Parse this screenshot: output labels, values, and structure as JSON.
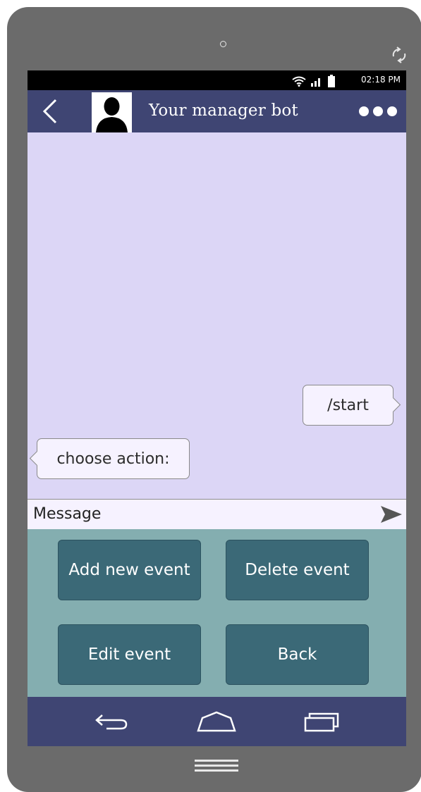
{
  "status_bar": {
    "time": "02:18 PM",
    "icons": [
      "wifi-icon",
      "signal-icon",
      "battery-icon"
    ]
  },
  "app_bar": {
    "title": "Your manager bot",
    "back_icon": "chevron-left-icon",
    "avatar_icon": "person-icon",
    "menu_icon": "more-dots-icon"
  },
  "chat": {
    "messages": [
      {
        "direction": "out",
        "text": "/start"
      },
      {
        "direction": "in",
        "text": "choose action:"
      }
    ]
  },
  "composer": {
    "placeholder": "Message",
    "send_icon": "send-icon"
  },
  "keyboard": {
    "buttons": [
      {
        "label": "Add new event"
      },
      {
        "label": "Delete event"
      },
      {
        "label": "Edit event"
      },
      {
        "label": "Back"
      }
    ]
  },
  "system_nav": {
    "icons": [
      "back-arrow-icon",
      "home-icon",
      "recent-apps-icon"
    ]
  },
  "colors": {
    "app_bar": "#3f4573",
    "chat_background": "#dcd6f6",
    "keyboard_background": "#84aeb0",
    "keyboard_button": "#3b6977",
    "bubble": "#f6f2ff",
    "phone_body": "#6b6b6b"
  }
}
